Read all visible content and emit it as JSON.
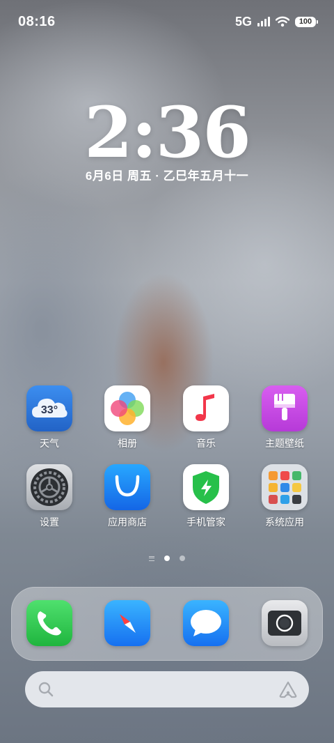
{
  "status": {
    "time": "08:16",
    "network": "5G",
    "battery": "100"
  },
  "lockscreen": {
    "clock": "2:36",
    "date": "6月6日 周五 · 乙巳年五月十一"
  },
  "apps": [
    {
      "label": "天气",
      "icon": "weather-icon",
      "temp": "33°"
    },
    {
      "label": "相册",
      "icon": "photos-icon"
    },
    {
      "label": "音乐",
      "icon": "music-icon"
    },
    {
      "label": "主题壁纸",
      "icon": "theme-wallpaper-icon"
    },
    {
      "label": "设置",
      "icon": "settings-icon"
    },
    {
      "label": "应用商店",
      "icon": "app-store-icon"
    },
    {
      "label": "手机管家",
      "icon": "phone-manager-icon"
    },
    {
      "label": "系统应用",
      "icon": "system-apps-folder-icon"
    }
  ],
  "dock": [
    {
      "icon": "phone-icon"
    },
    {
      "icon": "browser-compass-icon"
    },
    {
      "icon": "messages-icon"
    },
    {
      "icon": "camera-icon"
    }
  ],
  "pager": {
    "pages": 2,
    "active": 1
  },
  "colors": {
    "weather": "#2f7be0",
    "music": "#f2364a",
    "theme": "#d04be0",
    "store": "#1a8cf0",
    "manager": "#27c04a",
    "phone": "#2fd158",
    "messages": "#1a8cf0"
  }
}
